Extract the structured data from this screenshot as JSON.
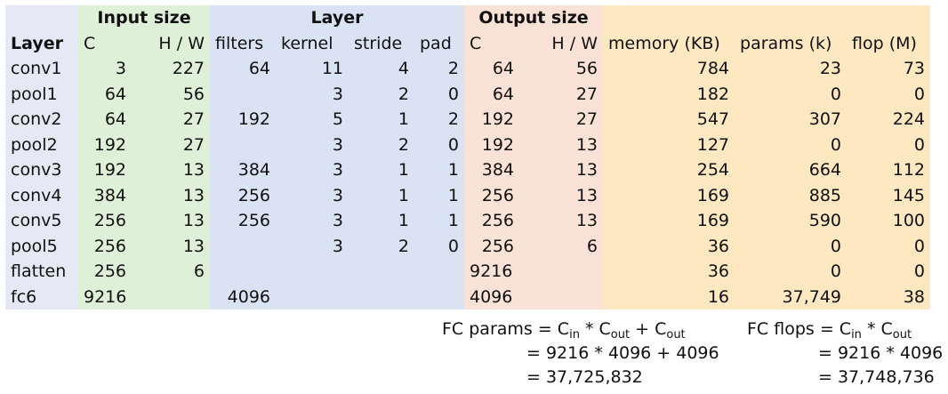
{
  "group_headers": {
    "input": "Input size",
    "layer": "Layer",
    "output": "Output size"
  },
  "columns": {
    "layer": "Layer",
    "in_c": "C",
    "in_hw_h": "H",
    "in_hw_slash": "/",
    "in_hw_w": "W",
    "filters": "filters",
    "kernel": "kernel",
    "stride": "stride",
    "pad": "pad",
    "out_c": "C",
    "out_hw_h": "H",
    "out_hw_slash": "/",
    "out_hw_w": "W",
    "memory": "memory (KB)",
    "params": "params (k)",
    "flop": "flop (M)"
  },
  "rows": [
    {
      "layer": "conv1",
      "in_c": "3",
      "in_hw": "227",
      "filters": "64",
      "kernel": "11",
      "stride": "4",
      "pad": "2",
      "out_c": "64",
      "out_hw": "56",
      "memory": "784",
      "params": "23",
      "flop": "73"
    },
    {
      "layer": "pool1",
      "in_c": "64",
      "in_hw": "56",
      "filters": "",
      "kernel": "3",
      "stride": "2",
      "pad": "0",
      "out_c": "64",
      "out_hw": "27",
      "memory": "182",
      "params": "0",
      "flop": "0"
    },
    {
      "layer": "conv2",
      "in_c": "64",
      "in_hw": "27",
      "filters": "192",
      "kernel": "5",
      "stride": "1",
      "pad": "2",
      "out_c": "192",
      "out_hw": "27",
      "memory": "547",
      "params": "307",
      "flop": "224"
    },
    {
      "layer": "pool2",
      "in_c": "192",
      "in_hw": "27",
      "filters": "",
      "kernel": "3",
      "stride": "2",
      "pad": "0",
      "out_c": "192",
      "out_hw": "13",
      "memory": "127",
      "params": "0",
      "flop": "0"
    },
    {
      "layer": "conv3",
      "in_c": "192",
      "in_hw": "13",
      "filters": "384",
      "kernel": "3",
      "stride": "1",
      "pad": "1",
      "out_c": "384",
      "out_hw": "13",
      "memory": "254",
      "params": "664",
      "flop": "112"
    },
    {
      "layer": "conv4",
      "in_c": "384",
      "in_hw": "13",
      "filters": "256",
      "kernel": "3",
      "stride": "1",
      "pad": "1",
      "out_c": "256",
      "out_hw": "13",
      "memory": "169",
      "params": "885",
      "flop": "145"
    },
    {
      "layer": "conv5",
      "in_c": "256",
      "in_hw": "13",
      "filters": "256",
      "kernel": "3",
      "stride": "1",
      "pad": "1",
      "out_c": "256",
      "out_hw": "13",
      "memory": "169",
      "params": "590",
      "flop": "100"
    },
    {
      "layer": "pool5",
      "in_c": "256",
      "in_hw": "13",
      "filters": "",
      "kernel": "3",
      "stride": "2",
      "pad": "0",
      "out_c": "256",
      "out_hw": "6",
      "memory": "36",
      "params": "0",
      "flop": "0"
    },
    {
      "layer": "flatten",
      "in_c": "256",
      "in_hw": "6",
      "filters": "",
      "kernel": "",
      "stride": "",
      "pad": "",
      "out_c": "9216",
      "out_hw": "",
      "memory": "36",
      "params": "0",
      "flop": "0"
    },
    {
      "layer": "fc6",
      "in_c": "9216",
      "in_hw": "",
      "filters": "4096",
      "kernel": "",
      "stride": "",
      "pad": "",
      "out_c": "4096",
      "out_hw": "",
      "memory": "16",
      "params": "37,749",
      "flop": "38"
    }
  ],
  "fc_params": {
    "label": "FC params = C",
    "sub_in": "in",
    "mid": " * C",
    "sub_out1": "out",
    "plus": " + C",
    "sub_out2": "out",
    "line2": "= 9216 * 4096 + 4096",
    "line3": "= 37,725,832"
  },
  "fc_flops": {
    "label": "FC flops = C",
    "sub_in": "in",
    "mid": " * C",
    "sub_out": "out",
    "line2": "= 9216 * 4096",
    "line3": "= 37,748,736"
  }
}
